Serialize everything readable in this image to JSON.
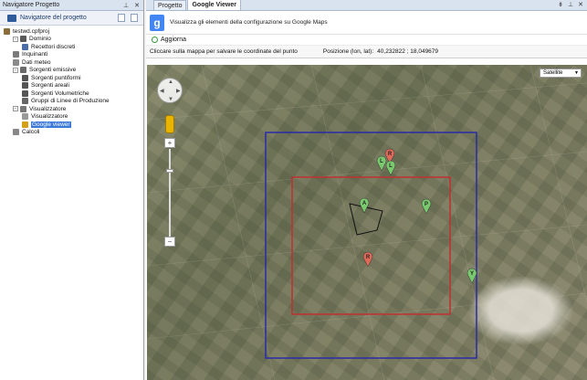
{
  "left_panel": {
    "title": "Navigatore Progetto",
    "header_label": "Navigatore del progetto",
    "tree": [
      {
        "label": "testwd.cpfproj",
        "indent": 0,
        "icon": "project-icon",
        "color": "#8a6d3b"
      },
      {
        "label": "Dominio",
        "indent": 1,
        "icon": "domain-icon",
        "color": "#5a5a5a",
        "exp": "−"
      },
      {
        "label": "Recettori discreti",
        "indent": 2,
        "icon": "receptor-icon",
        "color": "#4b6ea8"
      },
      {
        "label": "Inquinanti",
        "indent": 1,
        "icon": "pollutant-icon",
        "color": "#7a7a7a"
      },
      {
        "label": "Dati meteo",
        "indent": 1,
        "icon": "weather-icon",
        "color": "#8a8a8a"
      },
      {
        "label": "Sorgenti emissive",
        "indent": 1,
        "icon": "source-icon",
        "color": "#6b6b6b",
        "exp": "−"
      },
      {
        "label": "Sorgenti puntiformi",
        "indent": 2,
        "icon": "point-source-icon",
        "color": "#555"
      },
      {
        "label": "Sorgenti areali",
        "indent": 2,
        "icon": "area-source-icon",
        "color": "#555"
      },
      {
        "label": "Sorgenti Volumetriche",
        "indent": 2,
        "icon": "volume-source-icon",
        "color": "#555"
      },
      {
        "label": "Gruppi di Linee di Produzione",
        "indent": 2,
        "icon": "production-lines-icon",
        "color": "#666"
      },
      {
        "label": "Visualizzatore",
        "indent": 1,
        "icon": "viewer-icon",
        "color": "#777",
        "exp": "−"
      },
      {
        "label": "Visualizzatore",
        "indent": 2,
        "icon": "viewer-item-icon",
        "color": "#999"
      },
      {
        "label": "Google viewer",
        "indent": 2,
        "icon": "google-viewer-icon",
        "color": "#d4a017",
        "selected": true
      },
      {
        "label": "Calcoli",
        "indent": 1,
        "icon": "calc-icon",
        "color": "#888"
      }
    ]
  },
  "tabs": [
    {
      "label": "Progetto",
      "active": false
    },
    {
      "label": "Google Viewer",
      "active": true
    }
  ],
  "header": {
    "description": "Visualizza gli elementi della configurazione su Google Maps",
    "refresh_label": "Aggiorna"
  },
  "info_bar": {
    "hint": "Cliccare sulla mappa per salvare le coordinate del punto",
    "position_label": "Posizione (lon, lat):",
    "coordinates": "40,232822 ; 18,049679"
  },
  "map": {
    "type_selected": "Satellite",
    "markers": [
      {
        "letter": "R",
        "color": "#e06a5a"
      },
      {
        "letter": "L",
        "color": "#7bc96f"
      },
      {
        "letter": "L",
        "color": "#7bc96f"
      },
      {
        "letter": "A",
        "color": "#7bc96f"
      },
      {
        "letter": "P",
        "color": "#7bc96f"
      },
      {
        "letter": "R",
        "color": "#e06a5a"
      },
      {
        "letter": "Y",
        "color": "#7bc96f"
      }
    ],
    "outer_box_color": "#2a2aa8",
    "inner_box_color": "#c03030"
  }
}
